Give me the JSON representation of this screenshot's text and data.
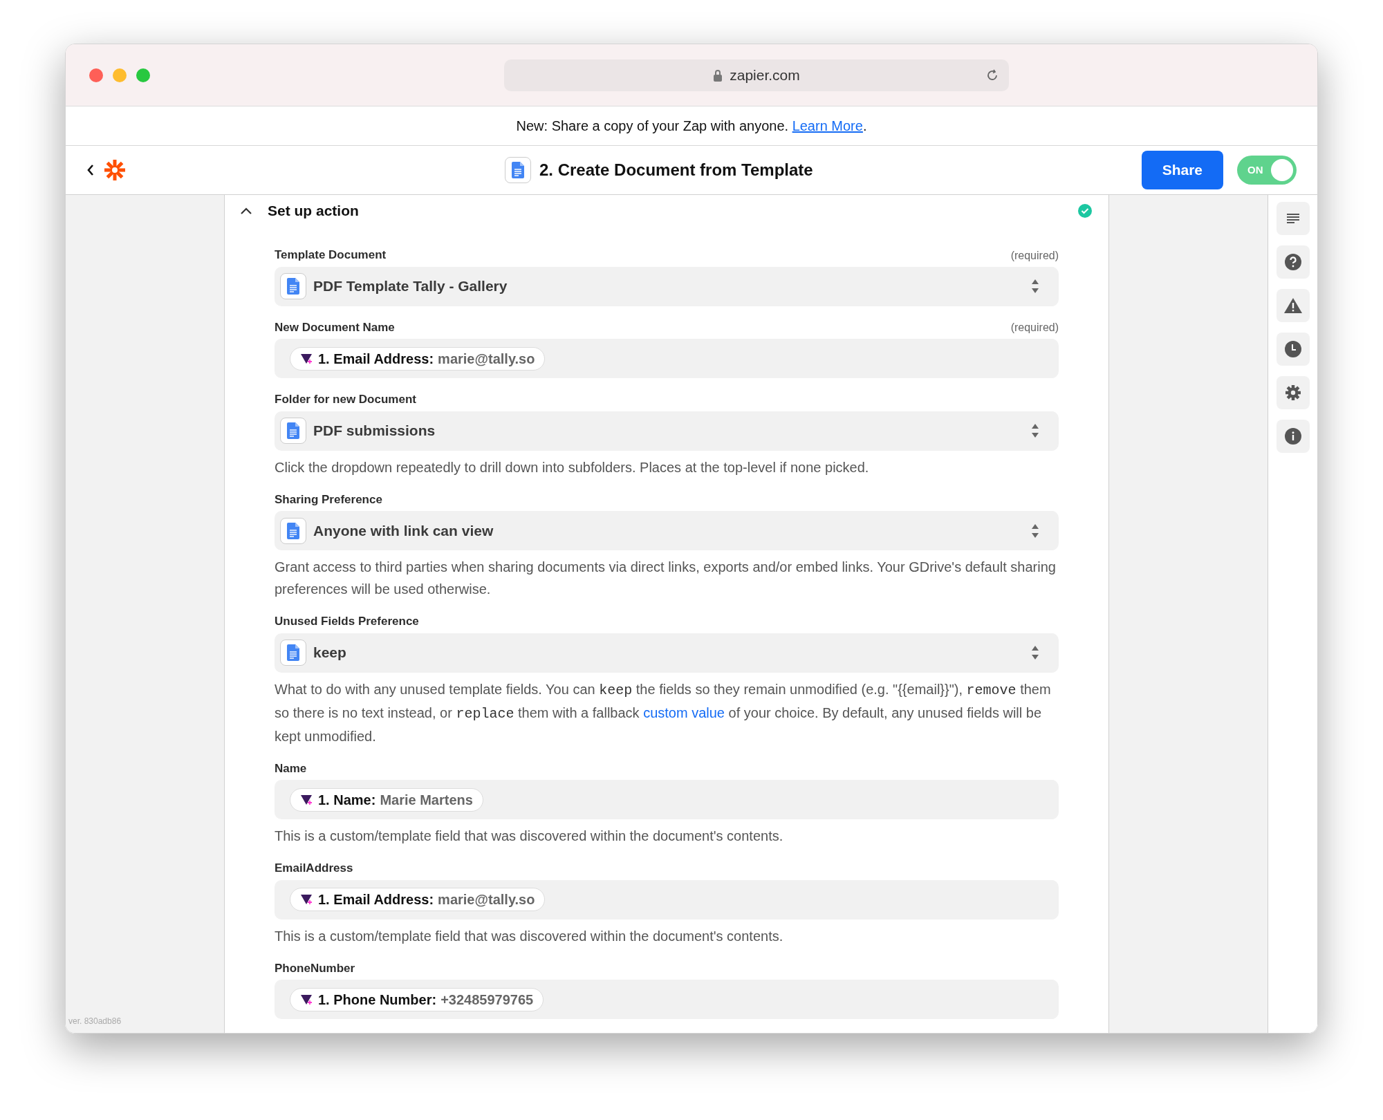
{
  "browser": {
    "url": "zapier.com"
  },
  "banner": {
    "text": "New: Share a copy of your Zap with anyone.",
    "link": "Learn More",
    "after": "."
  },
  "header": {
    "title": "2. Create Document from Template",
    "share": "Share",
    "toggle": {
      "label": "ON",
      "on": true
    }
  },
  "section": {
    "title": "Set up action",
    "expanded": true,
    "complete": true
  },
  "fields": [
    {
      "label": "Template Document",
      "required": "(required)",
      "kind": "select",
      "value": "PDF Template Tally - Gallery"
    },
    {
      "label": "New Document Name",
      "required": "(required)",
      "kind": "pill",
      "pill_label": "1. Email Address:",
      "pill_value": "marie@tally.so"
    },
    {
      "label": "Folder for new Document",
      "kind": "select",
      "value": "PDF submissions",
      "help": [
        {
          "kind": "text",
          "text": "Click the dropdown repeatedly to drill down into subfolders. Places at the top-level if none picked."
        }
      ]
    },
    {
      "label": "Sharing Preference",
      "kind": "select",
      "value": "Anyone with link can view",
      "help": [
        {
          "kind": "text",
          "text": "Grant access to third parties when sharing documents via direct links, exports and/or embed links. Your GDrive's default sharing preferences will be used otherwise."
        }
      ]
    },
    {
      "label": "Unused Fields Preference",
      "kind": "select",
      "value": "keep",
      "help": [
        {
          "kind": "text",
          "text": "What to do with any unused template fields. You can "
        },
        {
          "kind": "code",
          "text": "keep"
        },
        {
          "kind": "text",
          "text": " the fields so they remain unmodified (e.g. \"{{email}}\"), "
        },
        {
          "kind": "code",
          "text": "remove"
        },
        {
          "kind": "text",
          "text": " them so there is no text instead, or "
        },
        {
          "kind": "code",
          "text": "replace"
        },
        {
          "kind": "text",
          "text": " them with a fallback "
        },
        {
          "kind": "link",
          "text": "custom value"
        },
        {
          "kind": "text",
          "text": " of your choice. By default, any unused fields will be kept unmodified."
        }
      ]
    },
    {
      "label": "Name",
      "kind": "pill",
      "pill_label": "1. Name:",
      "pill_value": "Marie Martens",
      "help": [
        {
          "kind": "text",
          "text": "This is a custom/template field that was discovered within the document's contents."
        }
      ]
    },
    {
      "label": "EmailAddress",
      "kind": "pill",
      "pill_label": "1. Email Address:",
      "pill_value": "marie@tally.so",
      "help": [
        {
          "kind": "text",
          "text": "This is a custom/template field that was discovered within the document's contents."
        }
      ]
    },
    {
      "label": "PhoneNumber",
      "kind": "pill",
      "pill_label": "1. Phone Number:",
      "pill_value": "+32485979765"
    }
  ],
  "version": "ver. 830adb86"
}
